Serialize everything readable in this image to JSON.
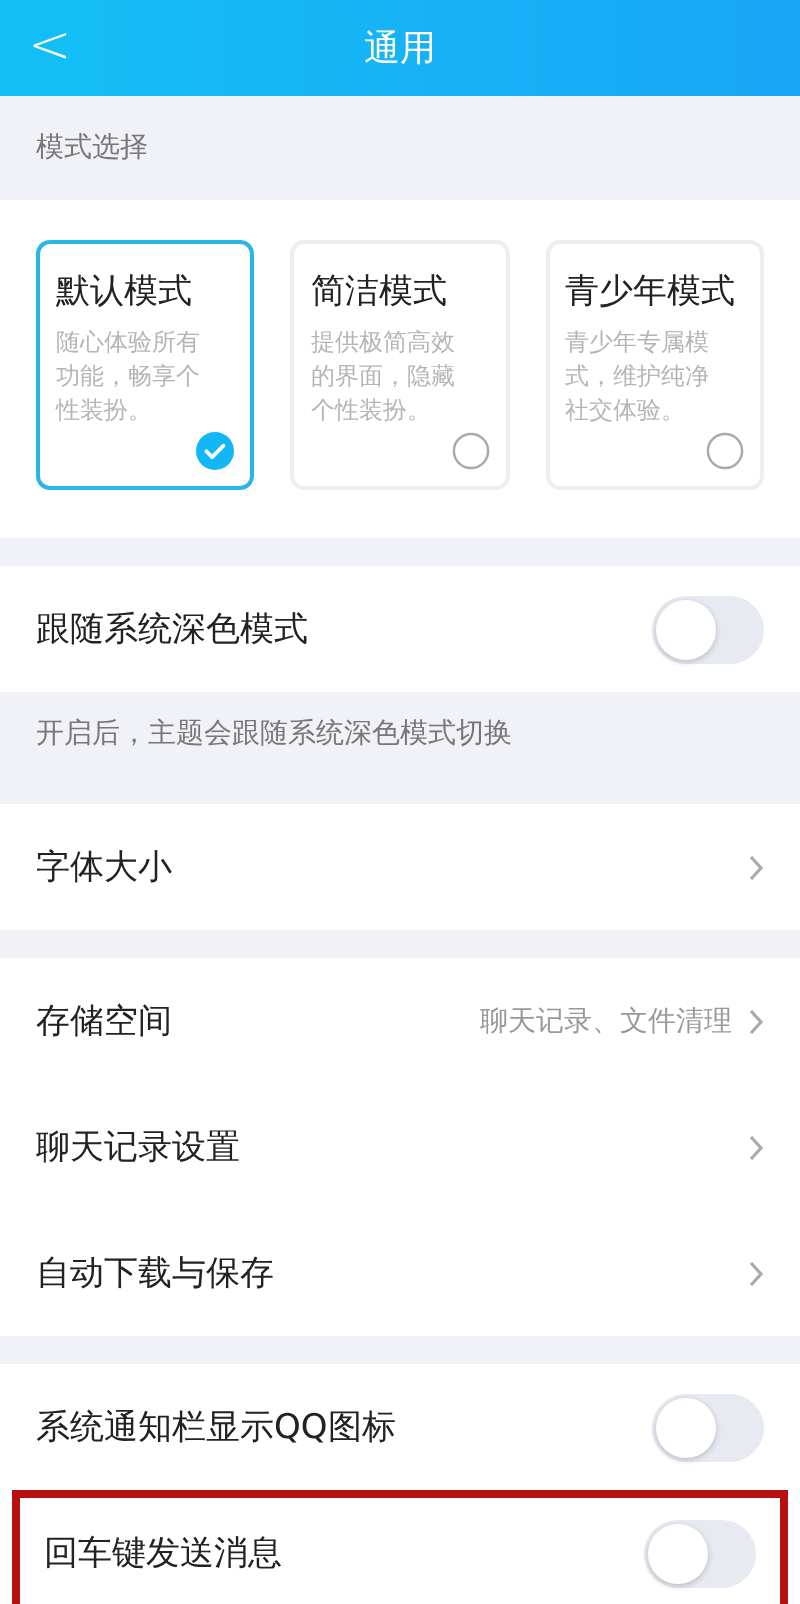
{
  "header": {
    "back": "<",
    "title": "通用"
  },
  "mode_section": {
    "label": "模式选择",
    "modes": [
      {
        "name": "默认模式",
        "desc": "随心体验所有功能，畅享个性装扮。",
        "selected": true
      },
      {
        "name": "简洁模式",
        "desc": "提供极简高效的界面，隐藏个性装扮。",
        "selected": false
      },
      {
        "name": "青少年模式",
        "desc": "青少年专属模式，维护纯净社交体验。",
        "selected": false
      }
    ]
  },
  "groups": [
    {
      "rows": [
        {
          "kind": "toggle",
          "label": "跟随系统深色模式",
          "on": false,
          "highlighted": false
        }
      ],
      "note": "开启后，主题会跟随系统深色模式切换"
    },
    {
      "rows": [
        {
          "kind": "link",
          "label": "字体大小",
          "highlighted": false
        }
      ]
    },
    {
      "rows": [
        {
          "kind": "link",
          "label": "存储空间",
          "value": "聊天记录、文件清理",
          "highlighted": false
        },
        {
          "kind": "link",
          "label": "聊天记录设置",
          "highlighted": false
        },
        {
          "kind": "link",
          "label": "自动下载与保存",
          "highlighted": false
        }
      ]
    },
    {
      "rows": [
        {
          "kind": "toggle",
          "label": "系统通知栏显示QQ图标",
          "on": false,
          "highlighted": false
        },
        {
          "kind": "toggle",
          "label": "回车键发送消息",
          "on": false,
          "highlighted": true
        }
      ]
    }
  ]
}
